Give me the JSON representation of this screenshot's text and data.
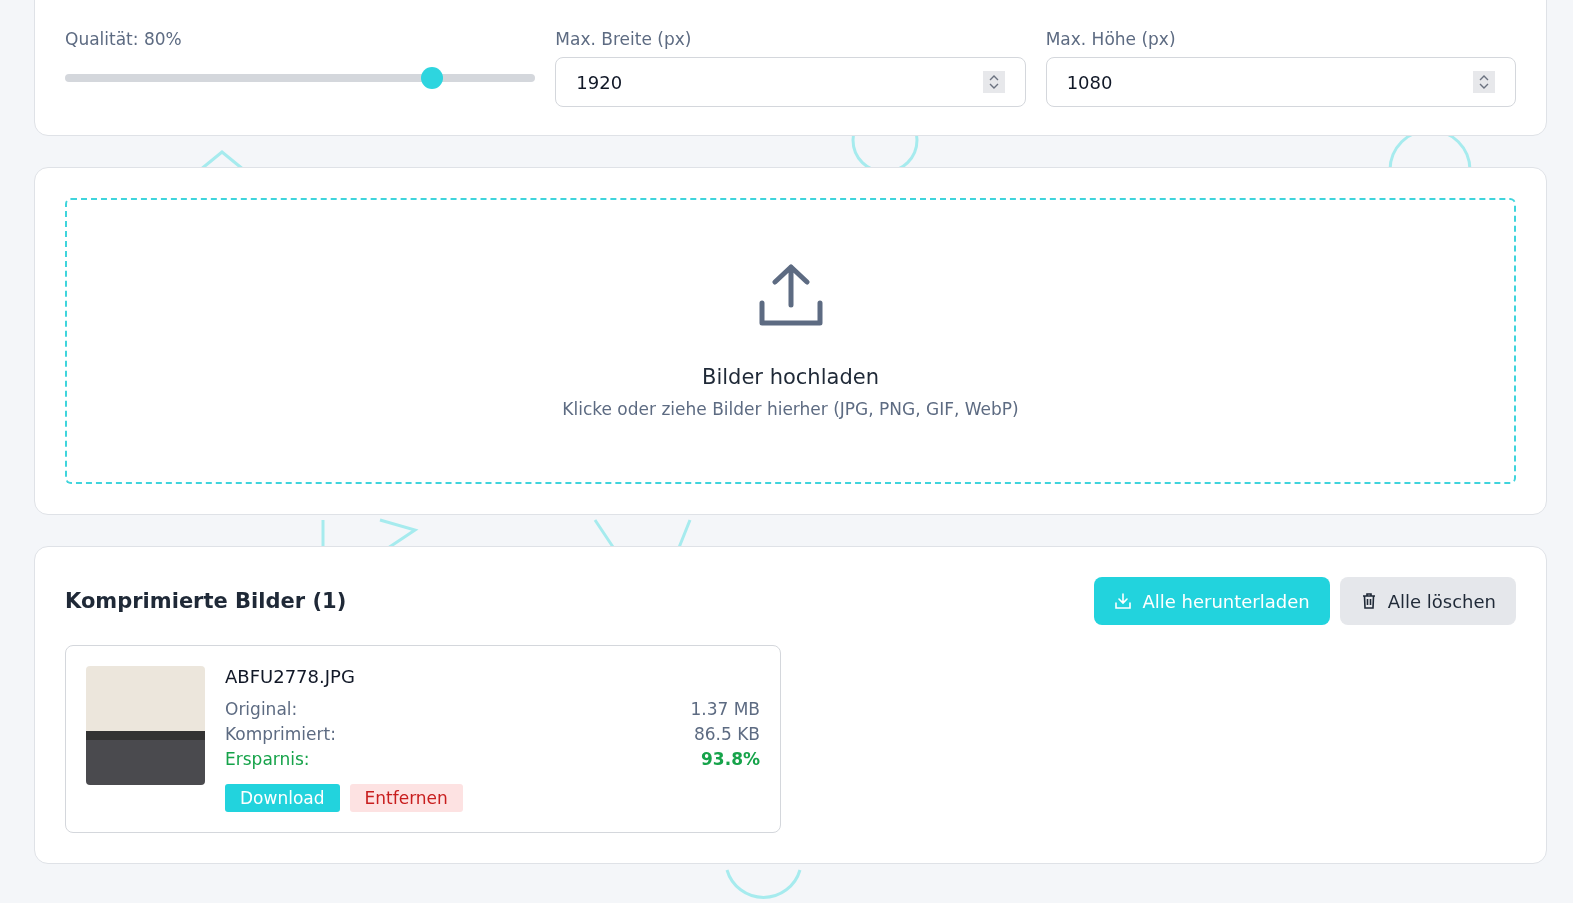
{
  "settings": {
    "quality": {
      "label": "Qualität: 80%",
      "level": 0.78
    },
    "fields": [
      {
        "label": "Max. Breite (px)",
        "value": "1920"
      },
      {
        "label": "Max. Höhe (px)",
        "value": "1080"
      }
    ]
  },
  "upload": {
    "title": "Bilder hochladen",
    "hint": "Klicke oder ziehe Bilder hierher (JPG, PNG, GIF, WebP)"
  },
  "results": {
    "title": "Komprimierte Bilder (1)",
    "actions": [
      {
        "kind": "primary",
        "label": "Alle herunterladen"
      },
      {
        "kind": "secondary",
        "label": "Alle löschen"
      }
    ],
    "items": [
      {
        "filename": "ABFU2778.JPG",
        "stats": [
          {
            "kind": "plain",
            "label": "Original:",
            "value": "1.37 MB"
          },
          {
            "kind": "plain",
            "label": "Komprimiert:",
            "value": "86.5 KB"
          },
          {
            "kind": "saving",
            "label": "Ersparnis:",
            "value": "93.8%"
          }
        ],
        "download": "Download",
        "remove": "Entfernen"
      }
    ]
  }
}
